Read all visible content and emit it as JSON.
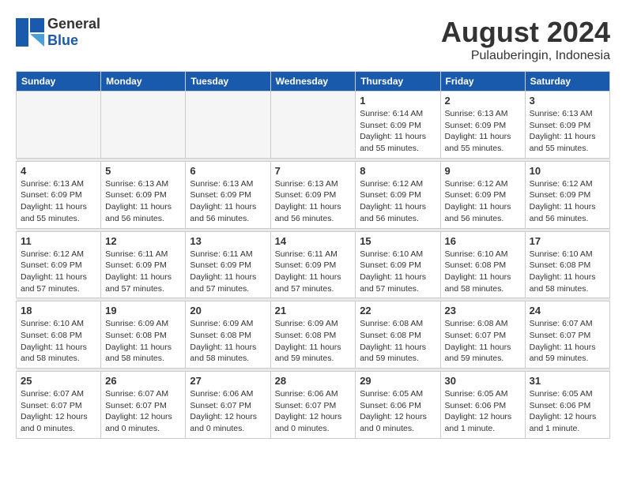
{
  "logo": {
    "general": "General",
    "blue": "Blue"
  },
  "title": {
    "month_year": "August 2024",
    "location": "Pulauberingin, Indonesia"
  },
  "headers": [
    "Sunday",
    "Monday",
    "Tuesday",
    "Wednesday",
    "Thursday",
    "Friday",
    "Saturday"
  ],
  "weeks": [
    [
      {
        "day": "",
        "info": ""
      },
      {
        "day": "",
        "info": ""
      },
      {
        "day": "",
        "info": ""
      },
      {
        "day": "",
        "info": ""
      },
      {
        "day": "1",
        "info": "Sunrise: 6:14 AM\nSunset: 6:09 PM\nDaylight: 11 hours\nand 55 minutes."
      },
      {
        "day": "2",
        "info": "Sunrise: 6:13 AM\nSunset: 6:09 PM\nDaylight: 11 hours\nand 55 minutes."
      },
      {
        "day": "3",
        "info": "Sunrise: 6:13 AM\nSunset: 6:09 PM\nDaylight: 11 hours\nand 55 minutes."
      }
    ],
    [
      {
        "day": "4",
        "info": "Sunrise: 6:13 AM\nSunset: 6:09 PM\nDaylight: 11 hours\nand 55 minutes."
      },
      {
        "day": "5",
        "info": "Sunrise: 6:13 AM\nSunset: 6:09 PM\nDaylight: 11 hours\nand 56 minutes."
      },
      {
        "day": "6",
        "info": "Sunrise: 6:13 AM\nSunset: 6:09 PM\nDaylight: 11 hours\nand 56 minutes."
      },
      {
        "day": "7",
        "info": "Sunrise: 6:13 AM\nSunset: 6:09 PM\nDaylight: 11 hours\nand 56 minutes."
      },
      {
        "day": "8",
        "info": "Sunrise: 6:12 AM\nSunset: 6:09 PM\nDaylight: 11 hours\nand 56 minutes."
      },
      {
        "day": "9",
        "info": "Sunrise: 6:12 AM\nSunset: 6:09 PM\nDaylight: 11 hours\nand 56 minutes."
      },
      {
        "day": "10",
        "info": "Sunrise: 6:12 AM\nSunset: 6:09 PM\nDaylight: 11 hours\nand 56 minutes."
      }
    ],
    [
      {
        "day": "11",
        "info": "Sunrise: 6:12 AM\nSunset: 6:09 PM\nDaylight: 11 hours\nand 57 minutes."
      },
      {
        "day": "12",
        "info": "Sunrise: 6:11 AM\nSunset: 6:09 PM\nDaylight: 11 hours\nand 57 minutes."
      },
      {
        "day": "13",
        "info": "Sunrise: 6:11 AM\nSunset: 6:09 PM\nDaylight: 11 hours\nand 57 minutes."
      },
      {
        "day": "14",
        "info": "Sunrise: 6:11 AM\nSunset: 6:09 PM\nDaylight: 11 hours\nand 57 minutes."
      },
      {
        "day": "15",
        "info": "Sunrise: 6:10 AM\nSunset: 6:09 PM\nDaylight: 11 hours\nand 57 minutes."
      },
      {
        "day": "16",
        "info": "Sunrise: 6:10 AM\nSunset: 6:08 PM\nDaylight: 11 hours\nand 58 minutes."
      },
      {
        "day": "17",
        "info": "Sunrise: 6:10 AM\nSunset: 6:08 PM\nDaylight: 11 hours\nand 58 minutes."
      }
    ],
    [
      {
        "day": "18",
        "info": "Sunrise: 6:10 AM\nSunset: 6:08 PM\nDaylight: 11 hours\nand 58 minutes."
      },
      {
        "day": "19",
        "info": "Sunrise: 6:09 AM\nSunset: 6:08 PM\nDaylight: 11 hours\nand 58 minutes."
      },
      {
        "day": "20",
        "info": "Sunrise: 6:09 AM\nSunset: 6:08 PM\nDaylight: 11 hours\nand 58 minutes."
      },
      {
        "day": "21",
        "info": "Sunrise: 6:09 AM\nSunset: 6:08 PM\nDaylight: 11 hours\nand 59 minutes."
      },
      {
        "day": "22",
        "info": "Sunrise: 6:08 AM\nSunset: 6:08 PM\nDaylight: 11 hours\nand 59 minutes."
      },
      {
        "day": "23",
        "info": "Sunrise: 6:08 AM\nSunset: 6:07 PM\nDaylight: 11 hours\nand 59 minutes."
      },
      {
        "day": "24",
        "info": "Sunrise: 6:07 AM\nSunset: 6:07 PM\nDaylight: 11 hours\nand 59 minutes."
      }
    ],
    [
      {
        "day": "25",
        "info": "Sunrise: 6:07 AM\nSunset: 6:07 PM\nDaylight: 12 hours\nand 0 minutes."
      },
      {
        "day": "26",
        "info": "Sunrise: 6:07 AM\nSunset: 6:07 PM\nDaylight: 12 hours\nand 0 minutes."
      },
      {
        "day": "27",
        "info": "Sunrise: 6:06 AM\nSunset: 6:07 PM\nDaylight: 12 hours\nand 0 minutes."
      },
      {
        "day": "28",
        "info": "Sunrise: 6:06 AM\nSunset: 6:07 PM\nDaylight: 12 hours\nand 0 minutes."
      },
      {
        "day": "29",
        "info": "Sunrise: 6:05 AM\nSunset: 6:06 PM\nDaylight: 12 hours\nand 0 minutes."
      },
      {
        "day": "30",
        "info": "Sunrise: 6:05 AM\nSunset: 6:06 PM\nDaylight: 12 hours\nand 1 minute."
      },
      {
        "day": "31",
        "info": "Sunrise: 6:05 AM\nSunset: 6:06 PM\nDaylight: 12 hours\nand 1 minute."
      }
    ]
  ]
}
